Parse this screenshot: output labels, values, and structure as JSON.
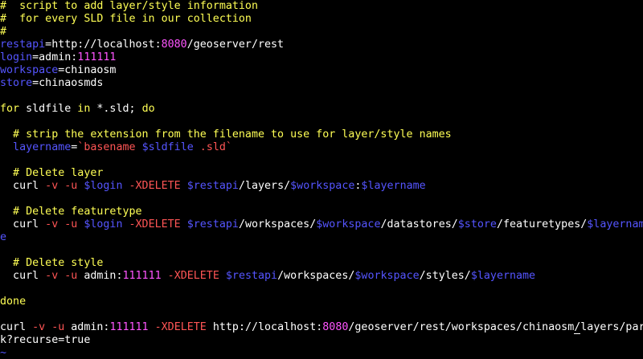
{
  "colors": {
    "background": "#000000",
    "default": "#ffffff",
    "comment": "#ffff55",
    "variable": "#5555ff",
    "number": "#ff55ff",
    "option": "#ff5555",
    "keyword": "#ffff55",
    "tilde": "#5555ff"
  },
  "editor": {
    "lines": [
      {
        "segments": [
          {
            "text": "#  script to add layer/style information",
            "style": "comment"
          }
        ]
      },
      {
        "segments": [
          {
            "text": "#  for every SLD file in our collection",
            "style": "comment"
          }
        ]
      },
      {
        "segments": [
          {
            "text": "#",
            "style": "comment"
          }
        ]
      },
      {
        "segments": [
          {
            "text": "restapi",
            "style": "variable"
          },
          {
            "text": "=http://localhost:",
            "style": "default"
          },
          {
            "text": "8080",
            "style": "number"
          },
          {
            "text": "/geoserver/rest",
            "style": "default"
          }
        ]
      },
      {
        "segments": [
          {
            "text": "login",
            "style": "variable"
          },
          {
            "text": "=admin:",
            "style": "default"
          },
          {
            "text": "111111",
            "style": "number"
          }
        ]
      },
      {
        "segments": [
          {
            "text": "workspace",
            "style": "variable"
          },
          {
            "text": "=chinaosm",
            "style": "default"
          }
        ]
      },
      {
        "segments": [
          {
            "text": "store",
            "style": "variable"
          },
          {
            "text": "=chinaosmds",
            "style": "default"
          }
        ]
      },
      {
        "segments": []
      },
      {
        "segments": [
          {
            "text": "for",
            "style": "keyword"
          },
          {
            "text": " sldfile ",
            "style": "default"
          },
          {
            "text": "in",
            "style": "keyword"
          },
          {
            "text": " *.sld; ",
            "style": "default"
          },
          {
            "text": "do",
            "style": "keyword"
          }
        ]
      },
      {
        "segments": []
      },
      {
        "segments": [
          {
            "text": "  # strip the extension from the filename to use for layer/style names",
            "style": "comment"
          }
        ]
      },
      {
        "segments": [
          {
            "text": "  layername",
            "style": "variable"
          },
          {
            "text": "=",
            "style": "default"
          },
          {
            "text": "`basename ",
            "style": "option"
          },
          {
            "text": "$sldfile",
            "style": "variable"
          },
          {
            "text": " .sld`",
            "style": "option"
          }
        ]
      },
      {
        "segments": []
      },
      {
        "segments": [
          {
            "text": "  # Delete layer",
            "style": "comment"
          }
        ]
      },
      {
        "segments": [
          {
            "text": "  curl ",
            "style": "default"
          },
          {
            "text": "-v -u ",
            "style": "option"
          },
          {
            "text": "$login",
            "style": "variable"
          },
          {
            "text": " -XDELETE ",
            "style": "option"
          },
          {
            "text": "$restapi",
            "style": "variable"
          },
          {
            "text": "/layers/",
            "style": "default"
          },
          {
            "text": "$workspace",
            "style": "variable"
          },
          {
            "text": ":",
            "style": "default"
          },
          {
            "text": "$layername",
            "style": "variable"
          }
        ]
      },
      {
        "segments": []
      },
      {
        "segments": [
          {
            "text": "  # Delete featuretype",
            "style": "comment"
          }
        ]
      },
      {
        "segments": [
          {
            "text": "  curl ",
            "style": "default"
          },
          {
            "text": "-v -u ",
            "style": "option"
          },
          {
            "text": "$login",
            "style": "variable"
          },
          {
            "text": " -XDELETE ",
            "style": "option"
          },
          {
            "text": "$restapi",
            "style": "variable"
          },
          {
            "text": "/workspaces/",
            "style": "default"
          },
          {
            "text": "$workspace",
            "style": "variable"
          },
          {
            "text": "/datastores/",
            "style": "default"
          },
          {
            "text": "$store",
            "style": "variable"
          },
          {
            "text": "/featuretypes/",
            "style": "default"
          },
          {
            "text": "$layernam",
            "style": "variable"
          }
        ]
      },
      {
        "segments": [
          {
            "text": "e",
            "style": "variable"
          }
        ]
      },
      {
        "segments": []
      },
      {
        "segments": [
          {
            "text": "  # Delete style",
            "style": "comment"
          }
        ]
      },
      {
        "segments": [
          {
            "text": "  curl ",
            "style": "default"
          },
          {
            "text": "-v -u ",
            "style": "option"
          },
          {
            "text": "admin:",
            "style": "default"
          },
          {
            "text": "111111",
            "style": "number"
          },
          {
            "text": " -XDELETE ",
            "style": "option"
          },
          {
            "text": "$restapi",
            "style": "variable"
          },
          {
            "text": "/workspaces/",
            "style": "default"
          },
          {
            "text": "$workspace",
            "style": "variable"
          },
          {
            "text": "/styles/",
            "style": "default"
          },
          {
            "text": "$layername",
            "style": "variable"
          }
        ]
      },
      {
        "segments": []
      },
      {
        "segments": [
          {
            "text": "done",
            "style": "keyword"
          }
        ]
      },
      {
        "segments": []
      },
      {
        "segments": [
          {
            "text": "curl ",
            "style": "default"
          },
          {
            "text": "-v -u ",
            "style": "option"
          },
          {
            "text": "admin:",
            "style": "default"
          },
          {
            "text": "111111",
            "style": "number"
          },
          {
            "text": " -XDELETE ",
            "style": "option"
          },
          {
            "text": "http://localhost:",
            "style": "default"
          },
          {
            "text": "8080",
            "style": "number"
          },
          {
            "text": "/geoserver/rest/workspaces/chinaosm",
            "style": "default"
          },
          {
            "text": "/",
            "style": "default",
            "cursor": true
          },
          {
            "text": "layers/par",
            "style": "default"
          }
        ]
      },
      {
        "segments": [
          {
            "text": "k?recurse",
            "style": "default"
          },
          {
            "text": "=",
            "style": "default"
          },
          {
            "text": "true",
            "style": "default"
          }
        ]
      }
    ],
    "tilde_lines": [
      "~",
      "~"
    ]
  }
}
